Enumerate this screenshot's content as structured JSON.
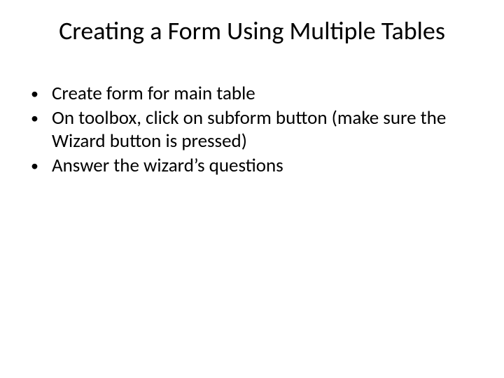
{
  "title": "Creating a Form Using Multiple Tables",
  "bullets": [
    "Create form for main table",
    "On toolbox, click on subform button (make sure the Wizard button is pressed)",
    "Answer the wizard’s questions"
  ]
}
